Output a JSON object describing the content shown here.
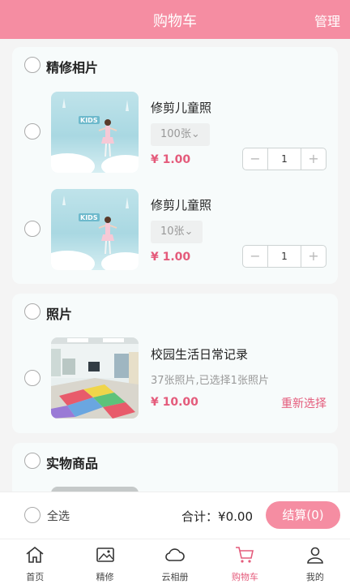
{
  "header": {
    "title": "购物车",
    "manage": "管理"
  },
  "sections": [
    {
      "title": "精修相片",
      "items": [
        {
          "name": "修剪儿童照",
          "spec": "100张⌄",
          "price": "¥ 1.00",
          "qty": "1"
        },
        {
          "name": "修剪儿童照",
          "spec": "10张⌄",
          "price": "¥ 1.00",
          "qty": "1"
        }
      ]
    },
    {
      "title": "照片",
      "items": [
        {
          "name": "校园生活日常记录",
          "desc": "37张照片,已选择1张照片",
          "price": "¥ 10.00",
          "reselect": "重新选择"
        }
      ]
    },
    {
      "title": "实物商品"
    }
  ],
  "thumb_text": "KIDS",
  "checkout": {
    "select_all": "全选",
    "total": "合计：¥0.00",
    "pay": "结算(0)"
  },
  "tabs": [
    {
      "label": "首页",
      "icon": "home-icon"
    },
    {
      "label": "精修",
      "icon": "image-icon"
    },
    {
      "label": "云相册",
      "icon": "cloud-icon"
    },
    {
      "label": "购物车",
      "icon": "cart-icon",
      "active": true
    },
    {
      "label": "我的",
      "icon": "user-icon"
    }
  ],
  "colors": {
    "brand": "#f58da2",
    "price": "#e45b7b"
  }
}
